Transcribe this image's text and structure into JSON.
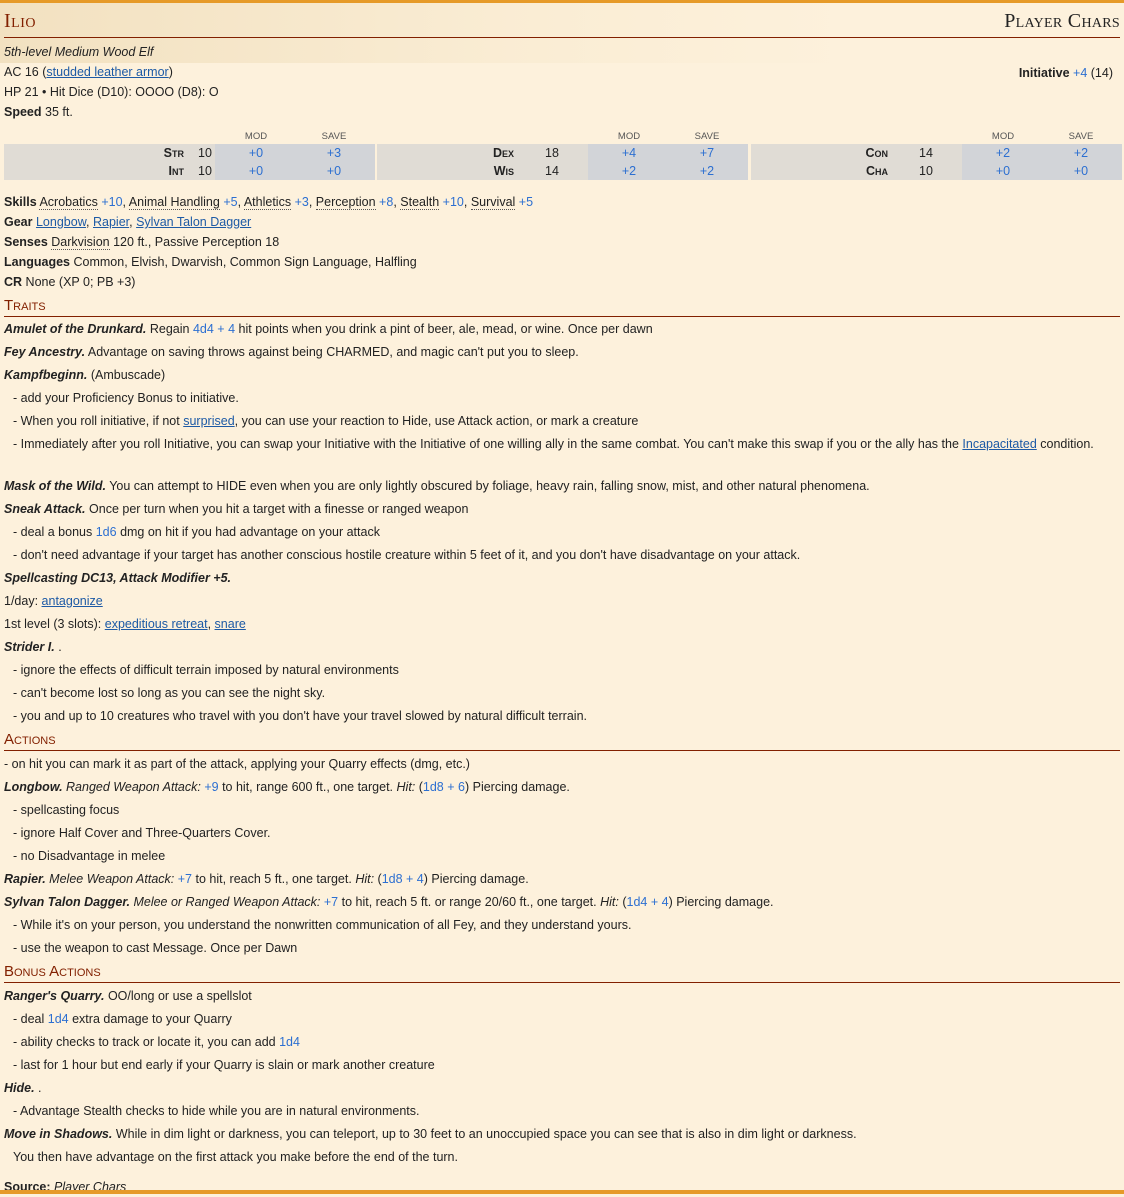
{
  "header": {
    "name": "Ilio",
    "source_tag": "Player Chars"
  },
  "meta": {
    "type_line": "5th-level Medium Wood Elf",
    "ac_label": "AC",
    "ac_value": "16",
    "ac_armor": "studded leather armor",
    "hp_line": "HP 21 • Hit Dice (D10): OOOO (D8): O",
    "speed_label": "Speed",
    "speed_value": "35 ft.",
    "initiative_label": "Initiative",
    "initiative_mod": "+4",
    "initiative_value": "(14)"
  },
  "stat_headers": {
    "mod": "MOD",
    "save": "SAVE"
  },
  "stats": [
    {
      "name": "Str",
      "score": "10",
      "mod": "+0",
      "save": "+3"
    },
    {
      "name": "Int",
      "score": "10",
      "mod": "+0",
      "save": "+0"
    },
    {
      "name": "Dex",
      "score": "18",
      "mod": "+4",
      "save": "+7"
    },
    {
      "name": "Wis",
      "score": "14",
      "mod": "+2",
      "save": "+2"
    },
    {
      "name": "Con",
      "score": "14",
      "mod": "+2",
      "save": "+2"
    },
    {
      "name": "Cha",
      "score": "10",
      "mod": "+0",
      "save": "+0"
    }
  ],
  "skills": {
    "label": "Skills",
    "items": [
      {
        "name": "Acrobatics",
        "value": "+10"
      },
      {
        "name": "Animal Handling",
        "value": "+5"
      },
      {
        "name": "Athletics",
        "value": "+3"
      },
      {
        "name": "Perception",
        "value": "+8"
      },
      {
        "name": "Stealth",
        "value": "+10"
      },
      {
        "name": "Survival",
        "value": "+5"
      }
    ]
  },
  "gear": {
    "label": "Gear",
    "items": [
      "Longbow",
      "Rapier",
      "Sylvan Talon Dagger"
    ]
  },
  "senses": {
    "label": "Senses",
    "term": "Darkvision",
    "rest": "120 ft., Passive Perception 18"
  },
  "languages": {
    "label": "Languages",
    "value": "Common, Elvish, Dwarvish, Common Sign Language, Halfling"
  },
  "cr": {
    "label": "CR",
    "value": "None (XP 0; PB +3)"
  },
  "sections": {
    "traits": "Traits",
    "actions": "Actions",
    "bonus": "Bonus Actions"
  },
  "traits": {
    "amulet_name": "Amulet of the Drunkard.",
    "amulet_pre": "Regain",
    "amulet_roll": "4d4 + 4",
    "amulet_post": "hit points when you drink a pint of beer, ale, mead, or wine. Once per dawn",
    "fey_name": "Fey Ancestry.",
    "fey_text": "Advantage on saving throws against being CHARMED, and magic can't put you to sleep.",
    "kampf_name": "Kampfbeginn.",
    "kampf_text": "(Ambuscade)",
    "kampf_1": "- add your Proficiency Bonus to initiative.",
    "kampf_2_pre": "- When you roll initiative, if not",
    "kampf_2_link": "surprised",
    "kampf_2_post": ", you can use your reaction to Hide, use Attack action, or mark a creature",
    "kampf_3_pre": "- Immediately after you roll Initiative, you can swap your Initiative with the Initiative of one willing ally in the same combat. You can't make this swap if you or the ally has the",
    "kampf_3_link": "Incapacitated",
    "kampf_3_post": "condition.",
    "mask_name": "Mask of the Wild.",
    "mask_text": "You can attempt to HIDE even when you are only lightly obscured by foliage, heavy rain, falling snow, mist, and other natural phenomena.",
    "sneak_name": "Sneak Attack.",
    "sneak_text": "Once per turn when you hit a target with a finesse or ranged weapon",
    "sneak_1_pre": "- deal a bonus",
    "sneak_1_roll": "1d6",
    "sneak_1_post": "dmg on hit if you had advantage on your attack",
    "sneak_2": "- don't need advantage if your target has another conscious hostile creature within 5 feet of it, and you don't have disadvantage on your attack.",
    "spell_name": "Spellcasting DC13, Attack Modifier +5.",
    "spell_1_label": "1/day:",
    "spell_1_link": "antagonize",
    "spell_2_label": "1st level (3 slots):",
    "spell_2_link_a": "expeditious retreat",
    "spell_2_link_b": "snare",
    "strider_name": "Strider I.",
    "strider_text": ".",
    "strider_1": "- ignore the effects of difficult terrain imposed by natural environments",
    "strider_2": "- can't become lost so long as you can see the night sky.",
    "strider_3": "- you and up to 10 creatures who travel with you don't have your travel slowed by natural difficult terrain."
  },
  "actions": {
    "intro": "- on hit you can mark it as part of the attack, applying your Quarry effects (dmg, etc.)",
    "longbow_name": "Longbow.",
    "longbow_type": "Ranged Weapon Attack:",
    "longbow_hit": "+9",
    "longbow_mid": "to hit, range 600 ft., one target.",
    "hit_label": "Hit:",
    "longbow_dmg": "1d8 + 6",
    "longbow_post": "Piercing damage.",
    "longbow_1": "- spellcasting focus",
    "longbow_2": "- ignore Half Cover and Three-Quarters Cover.",
    "longbow_3": "- no Disadvantage in melee",
    "rapier_name": "Rapier.",
    "rapier_type": "Melee Weapon Attack:",
    "rapier_hit": "+7",
    "rapier_mid": "to hit, reach 5 ft., one target.",
    "rapier_dmg": "1d8 + 4",
    "rapier_post": "Piercing damage.",
    "dagger_name": "Sylvan Talon Dagger.",
    "dagger_type": "Melee or Ranged Weapon Attack:",
    "dagger_hit": "+7",
    "dagger_mid": "to hit, reach 5 ft. or range 20/60 ft., one target.",
    "dagger_dmg": "1d4 + 4",
    "dagger_post": "Piercing damage.",
    "dagger_1": "- While it's on your person, you understand the nonwritten communication of all Fey, and they understand yours.",
    "dagger_2": "- use the weapon to cast Message. Once per Dawn"
  },
  "bonus": {
    "quarry_name": "Ranger's Quarry.",
    "quarry_text": "OO/long or use a spellslot",
    "quarry_1_pre": "- deal",
    "quarry_1_roll": "1d4",
    "quarry_1_post": "extra damage to your Quarry",
    "quarry_2_pre": "- ability checks to track or locate it, you can add",
    "quarry_2_roll": "1d4",
    "quarry_3": "- last for 1 hour but end early if your Quarry is slain or mark another creature",
    "hide_name": "Hide.",
    "hide_text": ".",
    "hide_1": "- Advantage Stealth checks to hide while you are in natural environments.",
    "move_name": "Move in Shadows.",
    "move_text": "While in dim light or darkness, you can teleport, up to 30 feet to an unoccupied space you can see that is also in dim light or darkness.",
    "move_2": "You then have advantage on the first attack you make before the end of the turn."
  },
  "footer": {
    "source_label": "Source:",
    "source_value": "Player Chars"
  },
  "colors": {
    "accent": "#822000",
    "link": "#1d5aa5",
    "roll": "#2c6fd1",
    "bar": "#e69a28"
  }
}
